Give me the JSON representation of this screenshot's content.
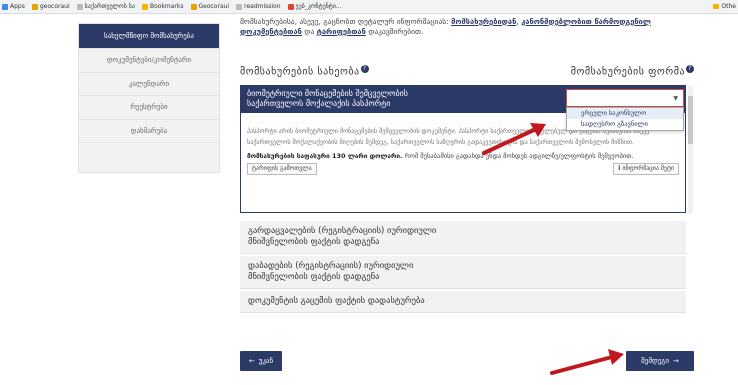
{
  "bookmarks": [
    {
      "label": "Apps",
      "color": "#4285f4"
    },
    {
      "label": "geocoraui",
      "color": "#e5a400"
    },
    {
      "label": "საქართველოს სა",
      "color": "#888888"
    },
    {
      "label": "Bookmarks",
      "color": "#f4b400"
    },
    {
      "label": "Geocoraui",
      "color": "#e5a400"
    },
    {
      "label": "readmission",
      "color": "#888888"
    },
    {
      "label": "ვებ_კონტენტი...",
      "color": "#db4437"
    }
  ],
  "other_bookmarks": "Othe",
  "sidebar": {
    "items": [
      {
        "label": "სახელმწიფო მომსახურება",
        "active": true
      },
      {
        "label": "დოკუმენტები/კომენტარი"
      },
      {
        "label": "კალენდარი"
      },
      {
        "label": "რეესტრები"
      },
      {
        "label": "დახმარება"
      }
    ]
  },
  "intro": {
    "text": "მომსახურებისა, ასევე, გაცნობთ დეტალურ ინფორმაციას: ",
    "link1": "მომსახურებიდან",
    "sep": ", ",
    "link2": "კანონმდებლობით წარმოდგენილ დოკუმენტებთან",
    "mid": " და ",
    "link3": "ტარიფებთან",
    "end": " დაკავშირებით."
  },
  "columns": {
    "left": "მომსახურების სახეობა",
    "right": "მომსახურების ფორმა",
    "left_help": "?",
    "right_help": "?"
  },
  "active_service": {
    "title_line1": "ბიომეტრიული მონაცემების შემცველობის",
    "title_line2": "საქართველოს მოქალაქის პასპორტი",
    "select_value": "",
    "dropdown": [
      "ვრცელი საკონსულო",
      "სადღესრო გზავნილი"
    ],
    "description": "პასპორტი არის ბიომეტრიული მონაცემების შემცველობის დოკუმენტი. პასპორტი საქართველოს უფლებულ და გაცემა, შენახვისა ასევე საქართველოს მოქალაქეობის მიღების შემდეგ, საქართველოს საზღვრის გადაკვეთისთვის და საქართველოს შემოსვლის მიზნით.",
    "price_label": "მომსახურების საფასური 130 ლარი დოლარი.",
    "price_note": " რომ შესაბამისი გადახდა უნდა მოხდეს ადგილზე/ელფოსტის მეშვეობით.",
    "btn_tariff": "ტარიფის გამოთვლა",
    "btn_more": "ინფორმაცია მეტი"
  },
  "services": [
    {
      "line1": "გარდაცვალების (რეგისტრაციის) იურიდიული",
      "line2": "მნიშვნელობის ფაქტის დადგენა"
    },
    {
      "line1": "დაბადების (რეგისტრაციის) იურიდიული",
      "line2": "მნიშვნელობის ფაქტის დადგენა"
    },
    {
      "line1": "დოკუმენტის გაცემის ფაქტის დადასტურება",
      "line2": ""
    }
  ],
  "footer": {
    "back_label": "უკან",
    "next_label": "შემდეგი"
  },
  "colors": {
    "primary": "#2b3a67",
    "arrow": "#c0181e",
    "sidebar_bg": "#f2f2f2"
  }
}
